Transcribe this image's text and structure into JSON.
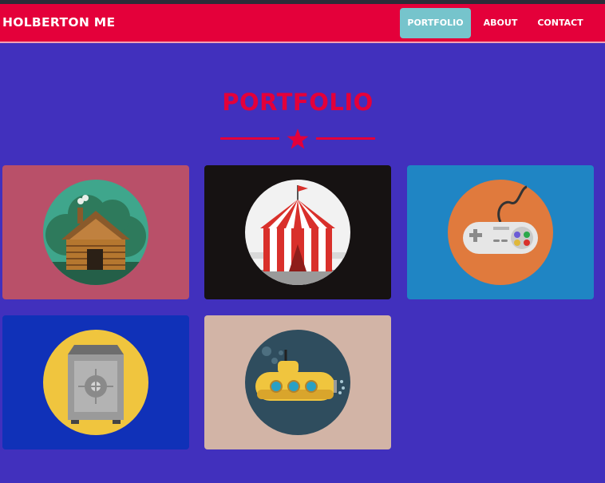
{
  "navbar": {
    "brand": "HOLBERTON ME",
    "links": [
      {
        "label": "PORTFOLIO",
        "active": true
      },
      {
        "label": "ABOUT",
        "active": false
      },
      {
        "label": "CONTACT",
        "active": false
      }
    ]
  },
  "portfolio": {
    "title": "PORTFOLIO",
    "divider_icon": "star-icon",
    "items": [
      {
        "icon": "log-cabin-icon",
        "background": "#b95069",
        "circle": "#3fa68c"
      },
      {
        "icon": "circus-tent-icon",
        "background": "#161212",
        "circle": "#f2f2f2"
      },
      {
        "icon": "game-controller-icon",
        "background": "#1f85c4",
        "circle": "#e07a3d"
      },
      {
        "icon": "safe-icon",
        "background": "#1031b8",
        "circle": "#f0c53e"
      },
      {
        "icon": "submarine-icon",
        "background": "#d2b4a6",
        "circle": "#2f4d5e"
      }
    ]
  },
  "colors": {
    "page_background": "#4130bd",
    "navbar": "#e4003a",
    "active_link": "#76c4cc",
    "title": "#e4003a"
  }
}
